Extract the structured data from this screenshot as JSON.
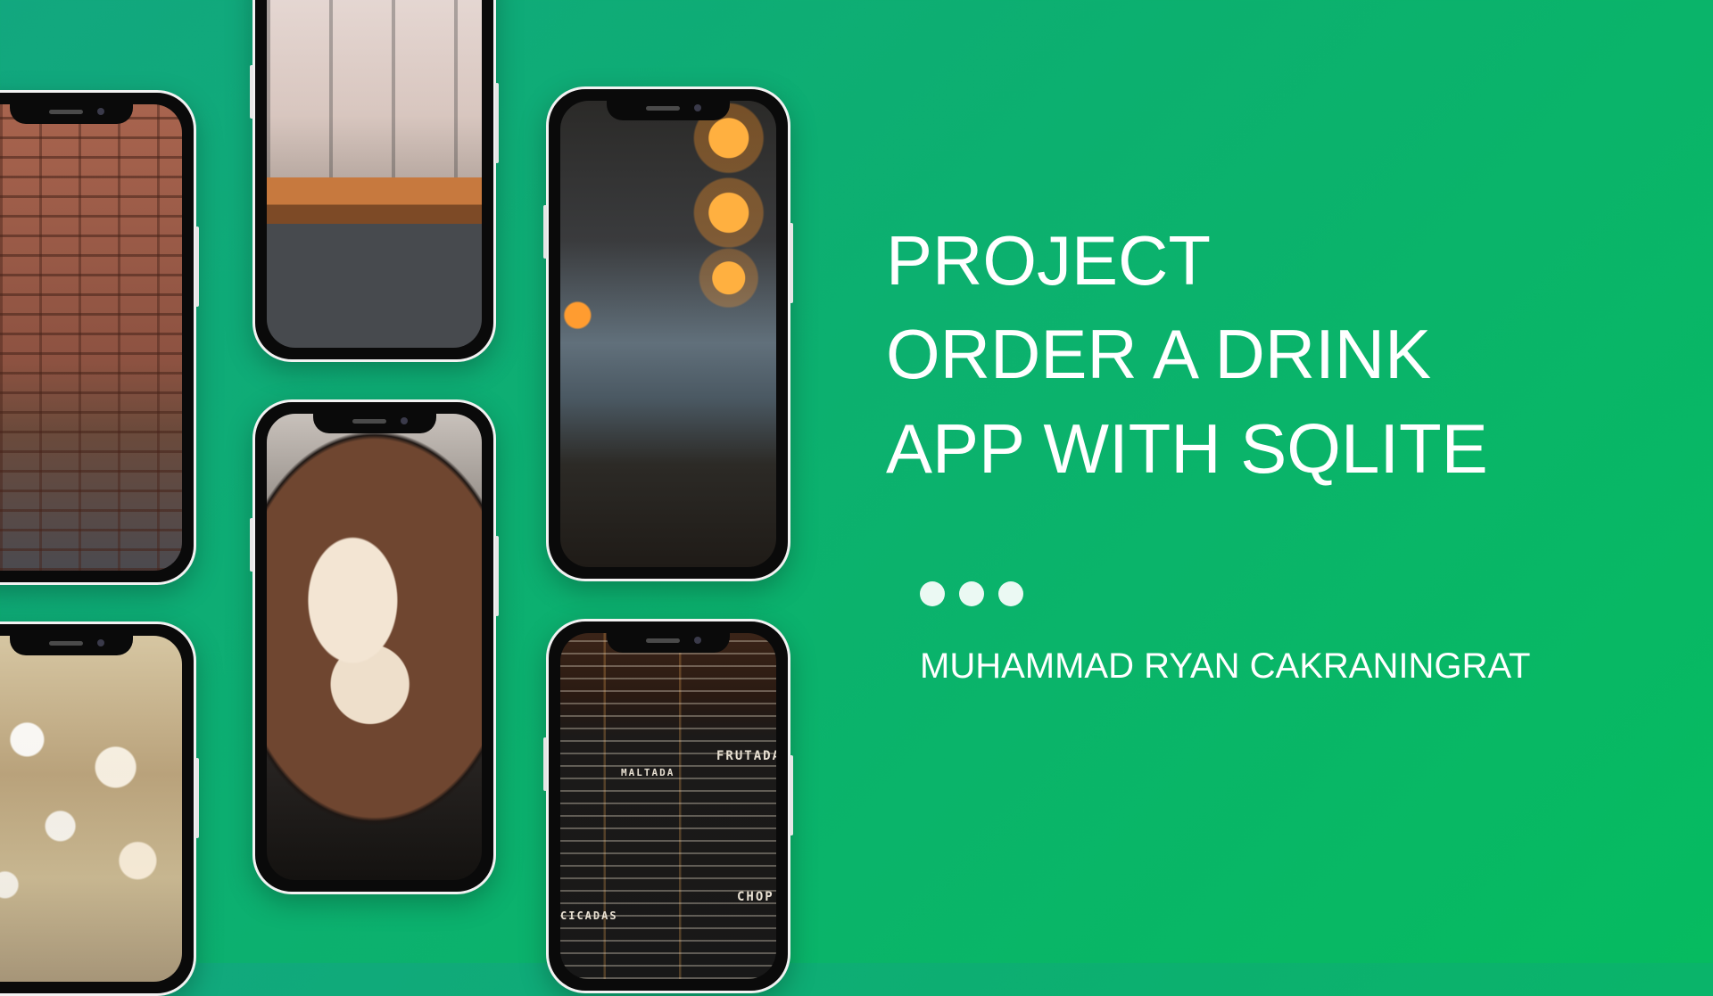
{
  "slide": {
    "title_lines": [
      "PROJECT",
      "ORDER A DRINK",
      "APP WITH SQLITE"
    ],
    "author": "MUHAMMAD RYAN CAKRANINGRAT",
    "background_colors": [
      "#12a77f",
      "#06bb60"
    ],
    "text_color": "#ffffff"
  },
  "phones": [
    {
      "scene": "brick-wall-skis-cafe"
    },
    {
      "scene": "bokeh-lights"
    },
    {
      "scene": "cafe-counter-stools"
    },
    {
      "scene": "latte-art-heart"
    },
    {
      "scene": "pendant-lamps-window"
    },
    {
      "scene": "chalkboard-menu",
      "menu_words": [
        "FRUTADA",
        "MALTADA",
        "CHOP",
        "CICADAS"
      ]
    }
  ]
}
